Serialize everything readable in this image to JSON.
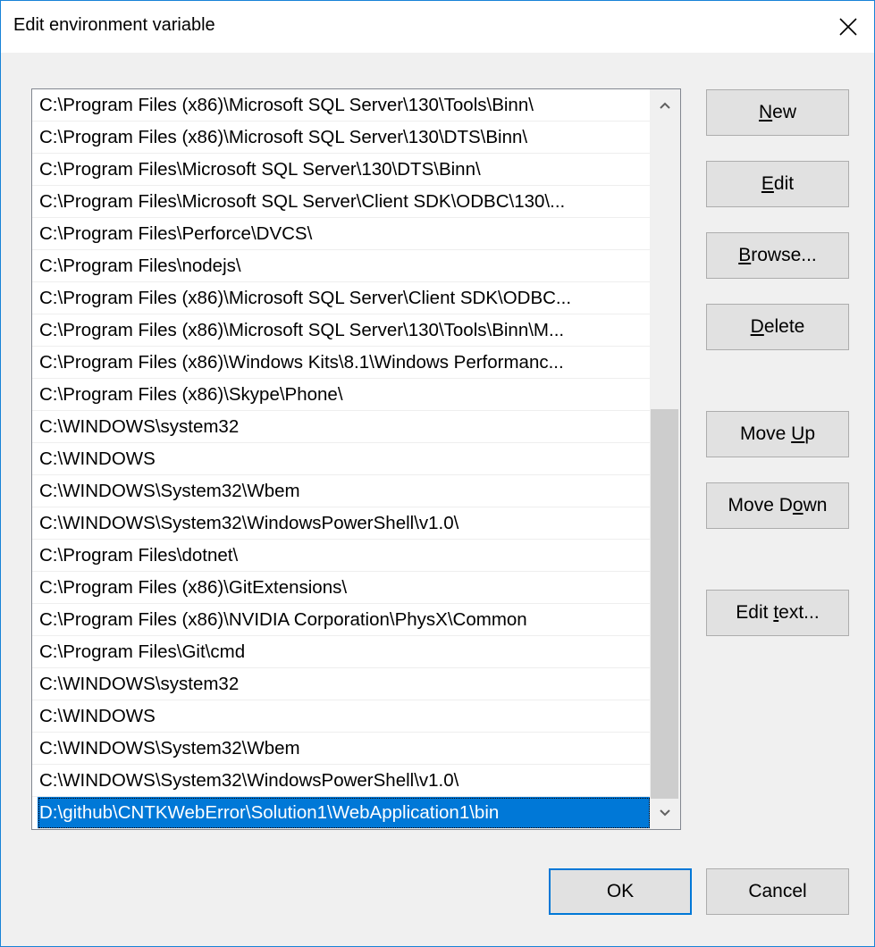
{
  "window": {
    "title": "Edit environment variable",
    "close_icon": "close-icon"
  },
  "list": {
    "items": [
      "C:\\Program Files (x86)\\Microsoft SQL Server\\130\\Tools\\Binn\\",
      "C:\\Program Files (x86)\\Microsoft SQL Server\\130\\DTS\\Binn\\",
      "C:\\Program Files\\Microsoft SQL Server\\130\\DTS\\Binn\\",
      "C:\\Program Files\\Microsoft SQL Server\\Client SDK\\ODBC\\130\\...",
      "C:\\Program Files\\Perforce\\DVCS\\",
      "C:\\Program Files\\nodejs\\",
      "C:\\Program Files (x86)\\Microsoft SQL Server\\Client SDK\\ODBC...",
      "C:\\Program Files (x86)\\Microsoft SQL Server\\130\\Tools\\Binn\\M...",
      "C:\\Program Files (x86)\\Windows Kits\\8.1\\Windows Performanc...",
      "C:\\Program Files (x86)\\Skype\\Phone\\",
      "C:\\WINDOWS\\system32",
      "C:\\WINDOWS",
      "C:\\WINDOWS\\System32\\Wbem",
      "C:\\WINDOWS\\System32\\WindowsPowerShell\\v1.0\\",
      "C:\\Program Files\\dotnet\\",
      "C:\\Program Files (x86)\\GitExtensions\\",
      "C:\\Program Files (x86)\\NVIDIA Corporation\\PhysX\\Common",
      "C:\\Program Files\\Git\\cmd",
      "C:\\WINDOWS\\system32",
      "C:\\WINDOWS",
      "C:\\WINDOWS\\System32\\Wbem",
      "C:\\WINDOWS\\System32\\WindowsPowerShell\\v1.0\\",
      "D:\\github\\CNTKWebError\\Solution1\\WebApplication1\\bin"
    ],
    "selected_index": 22,
    "selection_color": "#0078d7"
  },
  "buttons": {
    "new": {
      "pre": "",
      "key": "N",
      "post": "ew"
    },
    "edit": {
      "pre": "",
      "key": "E",
      "post": "dit"
    },
    "browse": {
      "pre": "",
      "key": "B",
      "post": "rowse..."
    },
    "delete": {
      "pre": "",
      "key": "D",
      "post": "elete"
    },
    "move_up": {
      "pre": "Move ",
      "key": "U",
      "post": "p"
    },
    "move_down": {
      "pre": "Move D",
      "key": "o",
      "post": "wn"
    },
    "edit_text": {
      "pre": "Edit ",
      "key": "t",
      "post": "ext..."
    },
    "ok": "OK",
    "cancel": "Cancel"
  }
}
